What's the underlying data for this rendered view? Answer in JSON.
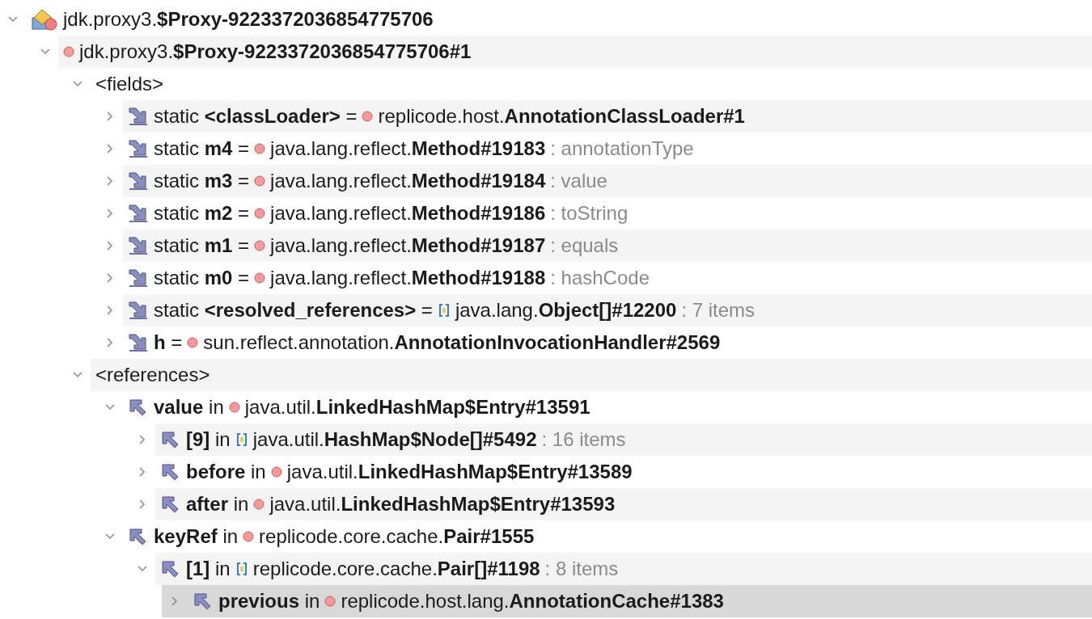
{
  "tree": [
    {
      "kind": "class",
      "label": "jdk.proxy3.**$Proxy-9223372036854775706**",
      "expanded": true,
      "selected": false,
      "children": [
        {
          "kind": "object",
          "label": "jdk.proxy3.**$Proxy-9223372036854775706#1**",
          "expanded": true,
          "selected": false,
          "children": [
            {
              "label": "<fields>",
              "expanded": true,
              "selected": false,
              "children": [
                {
                  "kind": "field",
                  "label": "static **<classLoader>** =",
                  "value": {
                    "kind": "object",
                    "text": "replicode.host.**AnnotationClassLoader#1**"
                  },
                  "expanded": false,
                  "selected": false
                },
                {
                  "kind": "field",
                  "label": "static **m4** =",
                  "value": {
                    "kind": "object",
                    "text": "java.lang.reflect.**Method#19183**"
                  },
                  "note": ": annotationType",
                  "expanded": false,
                  "selected": false
                },
                {
                  "kind": "field",
                  "label": "static **m3** =",
                  "value": {
                    "kind": "object",
                    "text": "java.lang.reflect.**Method#19184**"
                  },
                  "note": ": value",
                  "expanded": false,
                  "selected": false
                },
                {
                  "kind": "field",
                  "label": "static **m2** =",
                  "value": {
                    "kind": "object",
                    "text": "java.lang.reflect.**Method#19186**"
                  },
                  "note": ": toString",
                  "expanded": false,
                  "selected": false
                },
                {
                  "kind": "field",
                  "label": "static **m1** =",
                  "value": {
                    "kind": "object",
                    "text": "java.lang.reflect.**Method#19187**"
                  },
                  "note": ": equals",
                  "expanded": false,
                  "selected": false
                },
                {
                  "kind": "field",
                  "label": "static **m0** =",
                  "value": {
                    "kind": "object",
                    "text": "java.lang.reflect.**Method#19188**"
                  },
                  "note": ": hashCode",
                  "expanded": false,
                  "selected": false
                },
                {
                  "kind": "field",
                  "label": "static **<resolved_references>** =",
                  "value": {
                    "kind": "array",
                    "text": "java.lang.**Object[]#12200**"
                  },
                  "note": ": 7 items",
                  "expanded": false,
                  "selected": false
                },
                {
                  "kind": "field",
                  "label": "**h** =",
                  "value": {
                    "kind": "object",
                    "text": "sun.reflect.annotation.**AnnotationInvocationHandler#2569**"
                  },
                  "expanded": false,
                  "selected": false
                }
              ]
            },
            {
              "label": "<references>",
              "expanded": true,
              "selected": false,
              "children": [
                {
                  "kind": "reference",
                  "label": "**value** in",
                  "value": {
                    "kind": "object",
                    "text": "java.util.**LinkedHashMap$Entry#13591**"
                  },
                  "expanded": true,
                  "selected": false,
                  "children": [
                    {
                      "kind": "reference",
                      "label": "**[9]** in",
                      "value": {
                        "kind": "array",
                        "text": "java.util.**HashMap$Node[]#5492**"
                      },
                      "note": ": 16 items",
                      "expanded": false,
                      "selected": false
                    },
                    {
                      "kind": "reference",
                      "label": "**before** in",
                      "value": {
                        "kind": "object",
                        "text": "java.util.**LinkedHashMap$Entry#13589**"
                      },
                      "expanded": false,
                      "selected": false
                    },
                    {
                      "kind": "reference",
                      "label": "**after** in",
                      "value": {
                        "kind": "object",
                        "text": "java.util.**LinkedHashMap$Entry#13593**"
                      },
                      "expanded": false,
                      "selected": false
                    }
                  ]
                },
                {
                  "kind": "reference",
                  "label": "**keyRef** in",
                  "value": {
                    "kind": "object",
                    "text": "replicode.core.cache.**Pair#1555**"
                  },
                  "expanded": true,
                  "selected": false,
                  "children": [
                    {
                      "kind": "reference",
                      "label": "**[1]** in",
                      "value": {
                        "kind": "array",
                        "text": "replicode.core.cache.**Pair[]#1198**"
                      },
                      "note": ": 8 items",
                      "expanded": true,
                      "selected": false,
                      "children": [
                        {
                          "kind": "reference",
                          "label": "**previous** in",
                          "value": {
                            "kind": "object",
                            "text": "replicode.host.lang.**AnnotationCache#1383**"
                          },
                          "expanded": false,
                          "selected": true
                        }
                      ]
                    }
                  ]
                }
              ]
            }
          ]
        }
      ]
    }
  ]
}
